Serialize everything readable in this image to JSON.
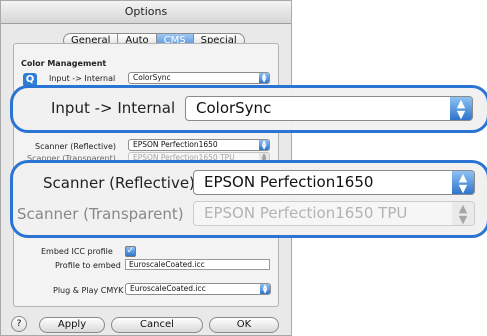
{
  "window": {
    "title": "Options"
  },
  "tabs": [
    "General",
    "Auto",
    "CMS",
    "Special"
  ],
  "selected_tab": "CMS",
  "section_title": "Color Management",
  "input_internal": {
    "label": "Input -> Internal",
    "value": "ColorSync"
  },
  "scanner_reflective": {
    "label": "Scanner (Reflective)",
    "value": "EPSON Perfection1650"
  },
  "scanner_transparent": {
    "label": "Scanner (Transparent)",
    "value": "EPSON Perfection1650 TPU"
  },
  "embed_icc": {
    "label": "Embed ICC profile",
    "checked": true
  },
  "profile_to_embed": {
    "label": "Profile to embed",
    "value": "EuroscaleCoated.icc"
  },
  "plug_play": {
    "label": "Plug & Play CMYK",
    "value": "EuroscaleCoated.icc"
  },
  "buttons": {
    "apply": "Apply",
    "cancel": "Cancel",
    "ok": "OK"
  },
  "callout1": {
    "label": "Input -> Internal",
    "value": "ColorSync"
  },
  "callout2": {
    "label1": "Scanner (Reflective)",
    "value1": "EPSON Perfection1650",
    "label2": "Scanner (Transparent)",
    "value2": "EPSON Perfection1650 TPU"
  }
}
